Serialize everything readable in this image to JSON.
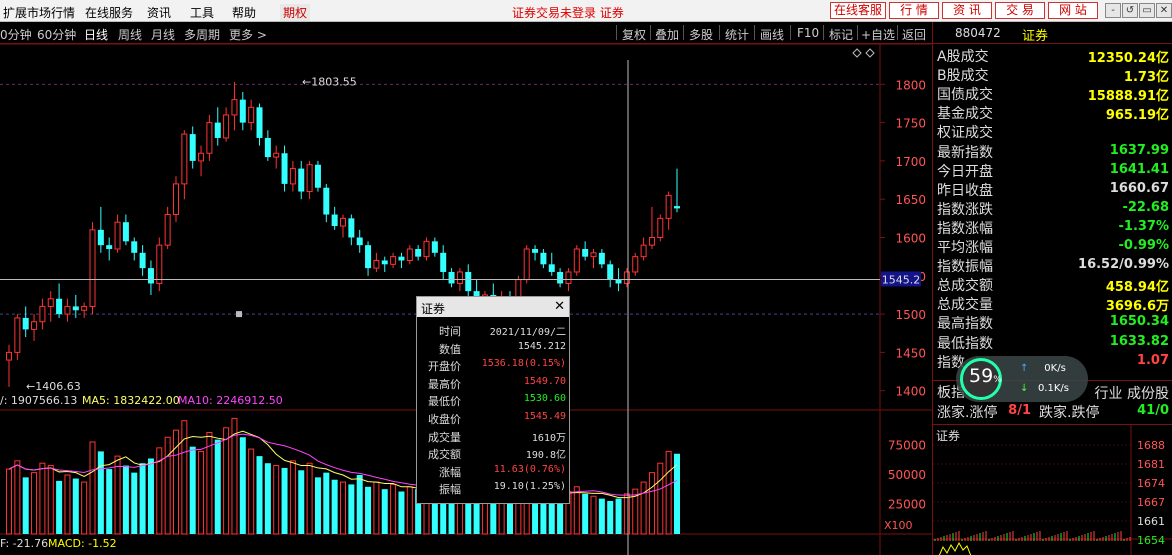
{
  "menubar": {
    "items": [
      "扩展市场行情",
      "在线服务",
      "资讯",
      "工具",
      "帮助"
    ],
    "futures_label": "期权",
    "center_text": "证券交易未登录  证券",
    "buttons": [
      "在线客服",
      "行 情",
      "资 讯",
      "交 易",
      "网 站"
    ],
    "window_buttons": [
      "-",
      "↺",
      "▭",
      "✕"
    ]
  },
  "toolbar": {
    "periods": [
      "0分钟",
      "60分钟",
      "日线",
      "周线",
      "月线",
      "多周期",
      "更多 >"
    ],
    "active_period": "日线",
    "actions": [
      "复权",
      "叠加",
      "多股",
      "统计",
      "画线",
      "F10",
      "标记",
      "+自选",
      "返回"
    ]
  },
  "right_panel": {
    "code": "880472",
    "name": "证券",
    "rows": [
      {
        "label": "A股成交",
        "value": "12350.24亿",
        "color": "yellow"
      },
      {
        "label": "B股成交",
        "value": "1.73亿",
        "color": "yellow"
      },
      {
        "label": "国债成交",
        "value": "15888.91亿",
        "color": "yellow"
      },
      {
        "label": "基金成交",
        "value": "965.19亿",
        "color": "yellow"
      },
      {
        "label": "权证成交",
        "value": "",
        "color": "yellow"
      },
      {
        "label": "最新指数",
        "value": "1637.99",
        "color": "green"
      },
      {
        "label": "今日开盘",
        "value": "1641.41",
        "color": "green"
      },
      {
        "label": "昨日收盘",
        "value": "1660.67",
        "color": "white"
      },
      {
        "label": "指数涨跌",
        "value": "-22.68",
        "color": "green"
      },
      {
        "label": "指数涨幅",
        "value": "-1.37%",
        "color": "green"
      },
      {
        "label": "平均涨幅",
        "value": "-0.99%",
        "color": "green"
      },
      {
        "label": "指数振幅",
        "value": "16.52/0.99%",
        "color": "white"
      },
      {
        "label": "总成交额",
        "value": "458.94亿",
        "color": "yellow"
      },
      {
        "label": "总成交量",
        "value": "3696.6万",
        "color": "yellow"
      },
      {
        "label": "最高指数",
        "value": "1650.34",
        "color": "green"
      },
      {
        "label": "最低指数",
        "value": "1633.82",
        "color": "green"
      },
      {
        "label": "指数",
        "value": "1.07",
        "color": "red"
      }
    ],
    "board_row1": {
      "left": "板指",
      "right": "行业 成份股"
    },
    "board_row2": {
      "l1": "涨家.涨停",
      "v1": "8/1",
      "l2": "跌家.跌停",
      "v2": "41/0"
    },
    "mini_title": "证券",
    "mini_ticks": [
      "1688",
      "1681",
      "1674",
      "1667",
      "1661",
      "1654"
    ]
  },
  "chart": {
    "price_ticks": [
      "1800",
      "1750",
      "1700",
      "1650",
      "1600",
      "1550",
      "1500",
      "1450",
      "1400"
    ],
    "current_price": "1545.2",
    "high_marker": "1803.55",
    "low_marker": "1406.63",
    "volume_ticks": [
      "75000",
      "50000",
      "25000"
    ],
    "volume_unit": "X100",
    "vol_legend": {
      "vol": "/: 1907566.13",
      "ma5": "MA5: 1832422.00",
      "ma10": "MA10: 2246912.50"
    },
    "macd_legend": {
      "dif": "F: -21.76",
      "macd": "MACD: -1.52"
    }
  },
  "tooltip": {
    "title": "证券",
    "close": "✕",
    "rows": [
      {
        "k": "时间",
        "v": "2021/11/09/二",
        "c": "white"
      },
      {
        "k": "数值",
        "v": "1545.212",
        "c": "white"
      },
      {
        "k": "开盘价",
        "v": "1536.18(0.15%)",
        "c": "red"
      },
      {
        "k": "最高价",
        "v": "1549.70",
        "c": "red"
      },
      {
        "k": "最低价",
        "v": "1530.60",
        "c": "green"
      },
      {
        "k": "收盘价",
        "v": "1545.49",
        "c": "red"
      },
      {
        "k": "成交量",
        "v": "1610万",
        "c": "white"
      },
      {
        "k": "成交额",
        "v": "190.8亿",
        "c": "white"
      },
      {
        "k": "涨幅",
        "v": "11.63(0.76%)",
        "c": "red"
      },
      {
        "k": "振幅",
        "v": "19.10(1.25%)",
        "c": "white"
      }
    ]
  },
  "speed": {
    "percent": "59",
    "pct_sign": "%",
    "up": "0K/s",
    "down": "0.1K/s"
  },
  "colors": {
    "up": "#ff3333",
    "down": "#33ffff",
    "ma5": "#ffff66",
    "ma10": "#ff44ff",
    "grid": "#7a1010"
  },
  "chart_data": {
    "type": "candlestick",
    "price_ylim": [
      1380,
      1820
    ],
    "candles": [
      [
        1440,
        1460,
        1405,
        1450
      ],
      [
        1450,
        1500,
        1440,
        1495
      ],
      [
        1495,
        1510,
        1470,
        1480
      ],
      [
        1480,
        1500,
        1465,
        1490
      ],
      [
        1490,
        1520,
        1480,
        1510
      ],
      [
        1510,
        1530,
        1490,
        1520
      ],
      [
        1520,
        1540,
        1495,
        1500
      ],
      [
        1500,
        1520,
        1490,
        1510
      ],
      [
        1510,
        1525,
        1495,
        1505
      ],
      [
        1505,
        1515,
        1495,
        1510
      ],
      [
        1510,
        1620,
        1500,
        1610
      ],
      [
        1610,
        1640,
        1580,
        1590
      ],
      [
        1590,
        1600,
        1570,
        1585
      ],
      [
        1585,
        1630,
        1580,
        1620
      ],
      [
        1620,
        1630,
        1590,
        1595
      ],
      [
        1595,
        1600,
        1570,
        1580
      ],
      [
        1580,
        1590,
        1550,
        1560
      ],
      [
        1560,
        1570,
        1525,
        1540
      ],
      [
        1540,
        1600,
        1530,
        1590
      ],
      [
        1590,
        1640,
        1585,
        1630
      ],
      [
        1630,
        1680,
        1620,
        1670
      ],
      [
        1670,
        1740,
        1650,
        1735
      ],
      [
        1735,
        1745,
        1690,
        1700
      ],
      [
        1700,
        1720,
        1680,
        1710
      ],
      [
        1710,
        1760,
        1700,
        1750
      ],
      [
        1750,
        1770,
        1720,
        1730
      ],
      [
        1730,
        1770,
        1725,
        1760
      ],
      [
        1760,
        1803,
        1740,
        1780
      ],
      [
        1780,
        1790,
        1740,
        1750
      ],
      [
        1750,
        1780,
        1740,
        1770
      ],
      [
        1770,
        1775,
        1720,
        1730
      ],
      [
        1730,
        1740,
        1700,
        1705
      ],
      [
        1705,
        1720,
        1690,
        1710
      ],
      [
        1710,
        1720,
        1660,
        1670
      ],
      [
        1670,
        1700,
        1660,
        1690
      ],
      [
        1690,
        1700,
        1650,
        1660
      ],
      [
        1660,
        1700,
        1650,
        1695
      ],
      [
        1695,
        1700,
        1660,
        1665
      ],
      [
        1665,
        1670,
        1620,
        1630
      ],
      [
        1630,
        1640,
        1610,
        1615
      ],
      [
        1615,
        1630,
        1600,
        1625
      ],
      [
        1625,
        1630,
        1590,
        1600
      ],
      [
        1600,
        1610,
        1580,
        1590
      ],
      [
        1590,
        1595,
        1550,
        1560
      ],
      [
        1560,
        1580,
        1555,
        1570
      ],
      [
        1570,
        1575,
        1555,
        1565
      ],
      [
        1565,
        1580,
        1560,
        1575
      ],
      [
        1575,
        1580,
        1560,
        1570
      ],
      [
        1570,
        1590,
        1565,
        1585
      ],
      [
        1585,
        1590,
        1570,
        1575
      ],
      [
        1575,
        1600,
        1570,
        1595
      ],
      [
        1595,
        1600,
        1575,
        1580
      ],
      [
        1580,
        1590,
        1545,
        1555
      ],
      [
        1555,
        1560,
        1535,
        1540
      ],
      [
        1540,
        1560,
        1530,
        1555
      ],
      [
        1555,
        1565,
        1520,
        1530
      ],
      [
        1530,
        1545,
        1510,
        1520
      ],
      [
        1520,
        1530,
        1505,
        1525
      ],
      [
        1525,
        1540,
        1510,
        1515
      ],
      [
        1515,
        1530,
        1505,
        1520
      ],
      [
        1520,
        1530,
        1505,
        1510
      ],
      [
        1510,
        1550,
        1505,
        1545
      ],
      [
        1545,
        1590,
        1540,
        1585
      ],
      [
        1585,
        1590,
        1570,
        1580
      ],
      [
        1580,
        1585,
        1560,
        1565
      ],
      [
        1565,
        1580,
        1550,
        1555
      ],
      [
        1555,
        1560,
        1535,
        1540
      ],
      [
        1540,
        1560,
        1530,
        1555
      ],
      [
        1555,
        1590,
        1550,
        1585
      ],
      [
        1585,
        1595,
        1570,
        1575
      ],
      [
        1575,
        1585,
        1560,
        1580
      ],
      [
        1580,
        1585,
        1560,
        1565
      ],
      [
        1565,
        1570,
        1535,
        1545
      ],
      [
        1545,
        1560,
        1530,
        1540
      ],
      [
        1540,
        1560,
        1535,
        1555
      ],
      [
        1555,
        1580,
        1550,
        1575
      ],
      [
        1575,
        1600,
        1570,
        1590
      ],
      [
        1590,
        1640,
        1585,
        1600
      ],
      [
        1600,
        1630,
        1595,
        1625
      ],
      [
        1625,
        1660,
        1610,
        1655
      ],
      [
        1641,
        1690,
        1633,
        1638
      ]
    ],
    "volumes": [
      55,
      62,
      48,
      52,
      60,
      58,
      45,
      50,
      47,
      44,
      78,
      70,
      55,
      66,
      58,
      52,
      60,
      64,
      73,
      82,
      88,
      96,
      74,
      70,
      86,
      80,
      90,
      98,
      82,
      72,
      66,
      60,
      58,
      56,
      62,
      54,
      60,
      48,
      52,
      46,
      44,
      42,
      50,
      40,
      44,
      38,
      42,
      36,
      40,
      38,
      44,
      40,
      34,
      30,
      38,
      36,
      30,
      28,
      34,
      30,
      28,
      40,
      46,
      38,
      36,
      34,
      30,
      36,
      40,
      34,
      32,
      30,
      28,
      30,
      34,
      38,
      44,
      52,
      60,
      70,
      68
    ],
    "vol_ylim": [
      0,
      100000
    ],
    "vol_scale": 1000
  }
}
